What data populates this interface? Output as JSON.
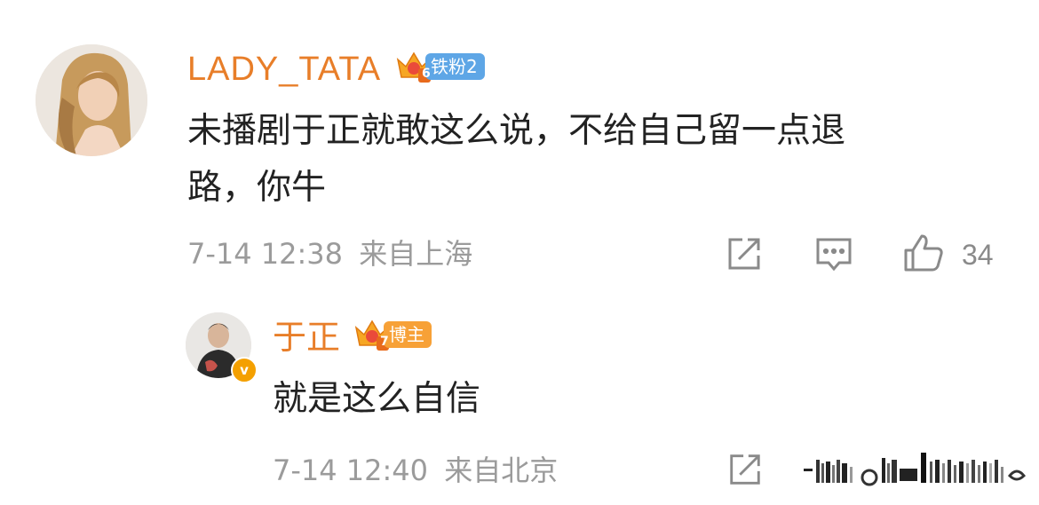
{
  "comment": {
    "username": "LADY_TATA",
    "badge": {
      "level": "6",
      "label": "铁粉2",
      "color": "#5ea6e6"
    },
    "text_line1": "未播剧于正就敢这么说，不给自己留一点退",
    "text_line2": "路，你牛",
    "time": "7-14 12:38",
    "location": "来自上海",
    "likes": "34",
    "icons": [
      "share-icon",
      "comment-icon",
      "like-icon"
    ]
  },
  "reply": {
    "username": "于正",
    "badge": {
      "level": "7",
      "label": "博主",
      "color": "#f7a137"
    },
    "verified_mark": "v",
    "text": "就是这么自信",
    "time": "7-14 12:40",
    "location": "来自北京",
    "icons": [
      "share-icon"
    ]
  },
  "colors": {
    "username": "#e87e29",
    "meta": "#9b9b9b",
    "body": "#222222"
  }
}
